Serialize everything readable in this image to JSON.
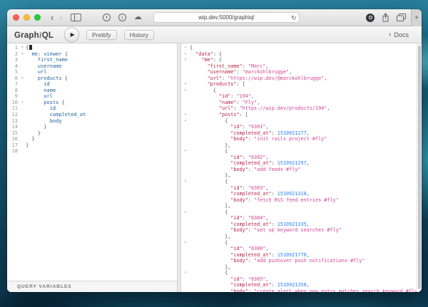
{
  "browser": {
    "url": "wip.dev:5000/graphiql"
  },
  "icons": {
    "back": "‹",
    "forward": "›",
    "reload": "↻",
    "cloud": "☁",
    "info": "i",
    "plus": "+",
    "play": "▶",
    "docs_chevron": "‹",
    "fold": "▾"
  },
  "graphiql": {
    "logo": [
      "Graph",
      "i",
      "QL"
    ],
    "prettify_label": "Prettify",
    "history_label": "History",
    "docs_label": "Docs",
    "query_variables_label": "QUERY VARIABLES"
  },
  "colors": {
    "field": "#1f61a0",
    "key": "#bb2247",
    "str": "#d64292",
    "num": "#2882f9",
    "punct": "#555555",
    "ln": "#999999",
    "fold": "#999999"
  },
  "query": {
    "lines": [
      {
        "n": 1,
        "f": true,
        "cursor": true,
        "t": [
          [
            "pn",
            "{"
          ]
        ]
      },
      {
        "n": 2,
        "f": true,
        "t": [
          [
            "pn",
            "  "
          ],
          [
            "fd",
            "me"
          ],
          [
            "pn",
            ": "
          ],
          [
            "fd",
            "viewer"
          ],
          [
            "pn",
            " {"
          ]
        ]
      },
      {
        "n": 3,
        "t": [
          [
            "pn",
            "    "
          ],
          [
            "fd",
            "first_name"
          ]
        ]
      },
      {
        "n": 4,
        "t": [
          [
            "pn",
            "    "
          ],
          [
            "fd",
            "username"
          ]
        ]
      },
      {
        "n": 5,
        "t": [
          [
            "pn",
            "    "
          ],
          [
            "fd",
            "url"
          ]
        ]
      },
      {
        "n": 6,
        "f": true,
        "t": [
          [
            "pn",
            "    "
          ],
          [
            "fd",
            "products"
          ],
          [
            "pn",
            " {"
          ]
        ]
      },
      {
        "n": 7,
        "t": [
          [
            "pn",
            "      "
          ],
          [
            "fd",
            "id"
          ]
        ]
      },
      {
        "n": 8,
        "t": [
          [
            "pn",
            "      "
          ],
          [
            "fd",
            "name"
          ]
        ]
      },
      {
        "n": 9,
        "t": [
          [
            "pn",
            "      "
          ],
          [
            "fd",
            "url"
          ]
        ]
      },
      {
        "n": 10,
        "f": true,
        "t": [
          [
            "pn",
            "      "
          ],
          [
            "fd",
            "posts"
          ],
          [
            "pn",
            " {"
          ]
        ]
      },
      {
        "n": 11,
        "t": [
          [
            "pn",
            "        "
          ],
          [
            "fd",
            "id"
          ]
        ]
      },
      {
        "n": 12,
        "t": [
          [
            "pn",
            "        "
          ],
          [
            "fd",
            "completed_at"
          ]
        ]
      },
      {
        "n": 13,
        "t": [
          [
            "pn",
            "        "
          ],
          [
            "fd",
            "body"
          ]
        ]
      },
      {
        "n": 14,
        "t": [
          [
            "pn",
            "      }"
          ]
        ]
      },
      {
        "n": 15,
        "t": [
          [
            "pn",
            "    }"
          ]
        ]
      },
      {
        "n": 16,
        "t": [
          [
            "pn",
            "  }"
          ]
        ]
      },
      {
        "n": 17,
        "t": [
          [
            "pn",
            "}"
          ]
        ]
      },
      {
        "n": 18,
        "t": []
      }
    ]
  },
  "response": {
    "lines": [
      {
        "f": true,
        "t": [
          [
            "pn",
            "{"
          ]
        ]
      },
      {
        "f": true,
        "t": [
          [
            "pn",
            "  "
          ],
          [
            "ky",
            "\"data\""
          ],
          [
            "pn",
            ": {"
          ]
        ]
      },
      {
        "f": true,
        "t": [
          [
            "pn",
            "    "
          ],
          [
            "ky",
            "\"me\""
          ],
          [
            "pn",
            ": {"
          ]
        ]
      },
      {
        "t": [
          [
            "pn",
            "      "
          ],
          [
            "ky",
            "\"first_name\""
          ],
          [
            "pn",
            ": "
          ],
          [
            "st",
            "\"Marc\""
          ],
          [
            "pn",
            ","
          ]
        ]
      },
      {
        "t": [
          [
            "pn",
            "      "
          ],
          [
            "ky",
            "\"username\""
          ],
          [
            "pn",
            ": "
          ],
          [
            "st",
            "\"marckohlbrugge\""
          ],
          [
            "pn",
            ","
          ]
        ]
      },
      {
        "t": [
          [
            "pn",
            "      "
          ],
          [
            "ky",
            "\"url\""
          ],
          [
            "pn",
            ": "
          ],
          [
            "st",
            "\"https://wip.dev/@marckohlbrugge\""
          ],
          [
            "pn",
            ","
          ]
        ]
      },
      {
        "f": true,
        "t": [
          [
            "pn",
            "      "
          ],
          [
            "ky",
            "\"products\""
          ],
          [
            "pn",
            ": ["
          ]
        ]
      },
      {
        "f": true,
        "t": [
          [
            "pn",
            "        {"
          ]
        ]
      },
      {
        "t": [
          [
            "pn",
            "          "
          ],
          [
            "ky",
            "\"id\""
          ],
          [
            "pn",
            ": "
          ],
          [
            "st",
            "\"194\""
          ],
          [
            "pn",
            ","
          ]
        ]
      },
      {
        "t": [
          [
            "pn",
            "          "
          ],
          [
            "ky",
            "\"name\""
          ],
          [
            "pn",
            ": "
          ],
          [
            "st",
            "\"Fly\""
          ],
          [
            "pn",
            ","
          ]
        ]
      },
      {
        "t": [
          [
            "pn",
            "          "
          ],
          [
            "ky",
            "\"url\""
          ],
          [
            "pn",
            ": "
          ],
          [
            "st",
            "\"https://wip.dev/products/194\""
          ],
          [
            "pn",
            ","
          ]
        ]
      },
      {
        "f": true,
        "t": [
          [
            "pn",
            "          "
          ],
          [
            "ky",
            "\"posts\""
          ],
          [
            "pn",
            ": ["
          ]
        ]
      },
      {
        "f": true,
        "t": [
          [
            "pn",
            "            {"
          ]
        ]
      },
      {
        "t": [
          [
            "pn",
            "              "
          ],
          [
            "ky",
            "\"id\""
          ],
          [
            "pn",
            ": "
          ],
          [
            "st",
            "\"6301\""
          ],
          [
            "pn",
            ","
          ]
        ]
      },
      {
        "t": [
          [
            "pn",
            "              "
          ],
          [
            "ky",
            "\"completed_at\""
          ],
          [
            "pn",
            ": "
          ],
          [
            "nm",
            "1510921277"
          ],
          [
            "pn",
            ","
          ]
        ]
      },
      {
        "t": [
          [
            "pn",
            "              "
          ],
          [
            "ky",
            "\"body\""
          ],
          [
            "pn",
            ": "
          ],
          [
            "st",
            "\"init rails project #fly\""
          ]
        ]
      },
      {
        "t": [
          [
            "pn",
            "            },"
          ]
        ]
      },
      {
        "f": true,
        "t": [
          [
            "pn",
            "            {"
          ]
        ]
      },
      {
        "t": [
          [
            "pn",
            "              "
          ],
          [
            "ky",
            "\"id\""
          ],
          [
            "pn",
            ": "
          ],
          [
            "st",
            "\"6302\""
          ],
          [
            "pn",
            ","
          ]
        ]
      },
      {
        "t": [
          [
            "pn",
            "              "
          ],
          [
            "ky",
            "\"completed_at\""
          ],
          [
            "pn",
            ": "
          ],
          [
            "nm",
            "1510921297"
          ],
          [
            "pn",
            ","
          ]
        ]
      },
      {
        "t": [
          [
            "pn",
            "              "
          ],
          [
            "ky",
            "\"body\""
          ],
          [
            "pn",
            ": "
          ],
          [
            "st",
            "\"add feeds #fly\""
          ]
        ]
      },
      {
        "t": [
          [
            "pn",
            "            },"
          ]
        ]
      },
      {
        "f": true,
        "t": [
          [
            "pn",
            "            {"
          ]
        ]
      },
      {
        "t": [
          [
            "pn",
            "              "
          ],
          [
            "ky",
            "\"id\""
          ],
          [
            "pn",
            ": "
          ],
          [
            "st",
            "\"6303\""
          ],
          [
            "pn",
            ","
          ]
        ]
      },
      {
        "t": [
          [
            "pn",
            "              "
          ],
          [
            "ky",
            "\"completed_at\""
          ],
          [
            "pn",
            ": "
          ],
          [
            "nm",
            "1510921318"
          ],
          [
            "pn",
            ","
          ]
        ]
      },
      {
        "t": [
          [
            "pn",
            "              "
          ],
          [
            "ky",
            "\"body\""
          ],
          [
            "pn",
            ": "
          ],
          [
            "st",
            "\"fetch RSS feed entries #fly\""
          ]
        ]
      },
      {
        "t": [
          [
            "pn",
            "            },"
          ]
        ]
      },
      {
        "f": true,
        "t": [
          [
            "pn",
            "            {"
          ]
        ]
      },
      {
        "t": [
          [
            "pn",
            "              "
          ],
          [
            "ky",
            "\"id\""
          ],
          [
            "pn",
            ": "
          ],
          [
            "st",
            "\"6304\""
          ],
          [
            "pn",
            ","
          ]
        ]
      },
      {
        "t": [
          [
            "pn",
            "              "
          ],
          [
            "ky",
            "\"completed_at\""
          ],
          [
            "pn",
            ": "
          ],
          [
            "nm",
            "1510921335"
          ],
          [
            "pn",
            ","
          ]
        ]
      },
      {
        "t": [
          [
            "pn",
            "              "
          ],
          [
            "ky",
            "\"body\""
          ],
          [
            "pn",
            ": "
          ],
          [
            "st",
            "\"set up keyword searches #fly\""
          ]
        ]
      },
      {
        "t": [
          [
            "pn",
            "            },"
          ]
        ]
      },
      {
        "f": true,
        "t": [
          [
            "pn",
            "            {"
          ]
        ]
      },
      {
        "t": [
          [
            "pn",
            "              "
          ],
          [
            "ky",
            "\"id\""
          ],
          [
            "pn",
            ": "
          ],
          [
            "st",
            "\"6306\""
          ],
          [
            "pn",
            ","
          ]
        ]
      },
      {
        "t": [
          [
            "pn",
            "              "
          ],
          [
            "ky",
            "\"completed_at\""
          ],
          [
            "pn",
            ": "
          ],
          [
            "nm",
            "1510921770"
          ],
          [
            "pn",
            ","
          ]
        ]
      },
      {
        "t": [
          [
            "pn",
            "              "
          ],
          [
            "ky",
            "\"body\""
          ],
          [
            "pn",
            ": "
          ],
          [
            "st",
            "\"add pushover push notifications #fly\""
          ]
        ]
      },
      {
        "t": [
          [
            "pn",
            "            },"
          ]
        ]
      },
      {
        "f": true,
        "t": [
          [
            "pn",
            "            {"
          ]
        ]
      },
      {
        "t": [
          [
            "pn",
            "              "
          ],
          [
            "ky",
            "\"id\""
          ],
          [
            "pn",
            ": "
          ],
          [
            "st",
            "\"6305\""
          ],
          [
            "pn",
            ","
          ]
        ]
      },
      {
        "t": [
          [
            "pn",
            "              "
          ],
          [
            "ky",
            "\"completed_at\""
          ],
          [
            "pn",
            ": "
          ],
          [
            "nm",
            "1510921358"
          ],
          [
            "pn",
            ","
          ]
        ]
      },
      {
        "t": [
          [
            "pn",
            "              "
          ],
          [
            "ky",
            "\"body\""
          ],
          [
            "pn",
            ": "
          ],
          [
            "st",
            "\"create alert when new entry matches search keyword #fly\""
          ]
        ]
      }
    ]
  }
}
